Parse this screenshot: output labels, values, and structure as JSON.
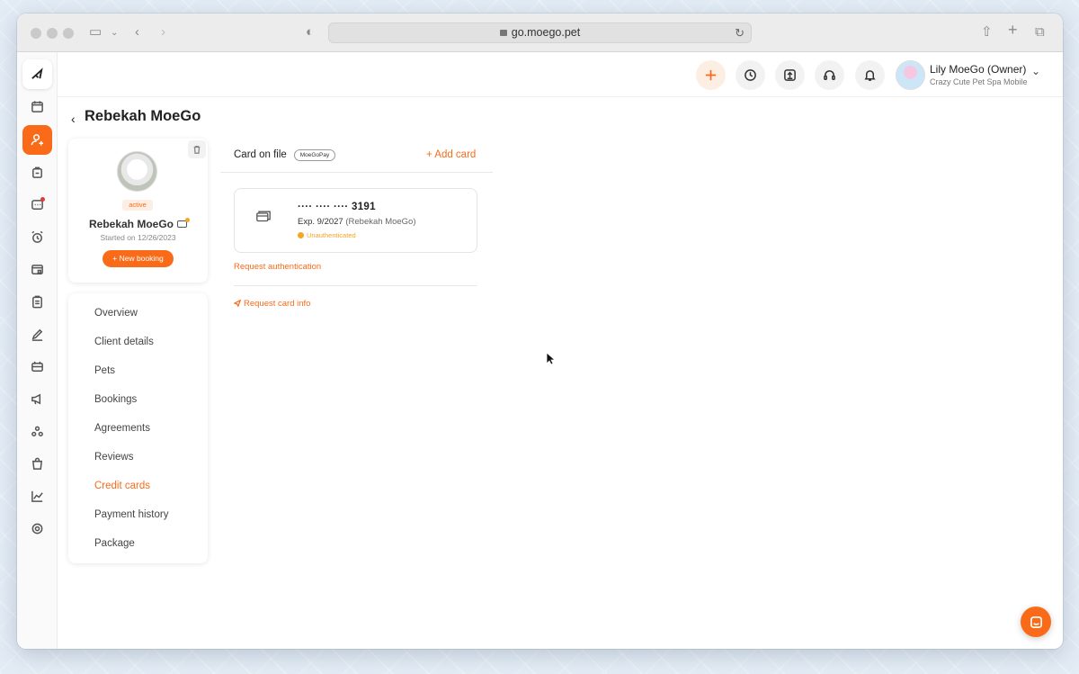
{
  "browser": {
    "url": "go.moego.pet"
  },
  "topbar": {
    "user_name": "Lily MoeGo (Owner)",
    "business_name": "Crazy Cute Pet Spa Mobile"
  },
  "page": {
    "title": "Rebekah MoeGo"
  },
  "profile": {
    "status": "active",
    "name": "Rebekah MoeGo",
    "started": "Started on 12/26/2023",
    "new_booking_label": "+ New booking"
  },
  "nav": {
    "items": [
      {
        "label": "Overview"
      },
      {
        "label": "Client details"
      },
      {
        "label": "Pets"
      },
      {
        "label": "Bookings"
      },
      {
        "label": "Agreements"
      },
      {
        "label": "Reviews"
      },
      {
        "label": "Credit cards"
      },
      {
        "label": "Payment history"
      },
      {
        "label": "Package"
      }
    ],
    "active": "Credit cards"
  },
  "cards": {
    "section_title": "Card on file",
    "pay_badge": "MoeGoPay",
    "add_card_label": "+ Add card",
    "card": {
      "number": "···· ···· ···· 3191",
      "expiry": "Exp. 9/2027",
      "holder": "(Rebekah MoeGo)",
      "status": "Unauthenticated"
    },
    "request_auth_label": "Request authentication",
    "request_info_label": "Request card info"
  },
  "colors": {
    "accent": "#f96b18",
    "warning": "#f5a623"
  }
}
